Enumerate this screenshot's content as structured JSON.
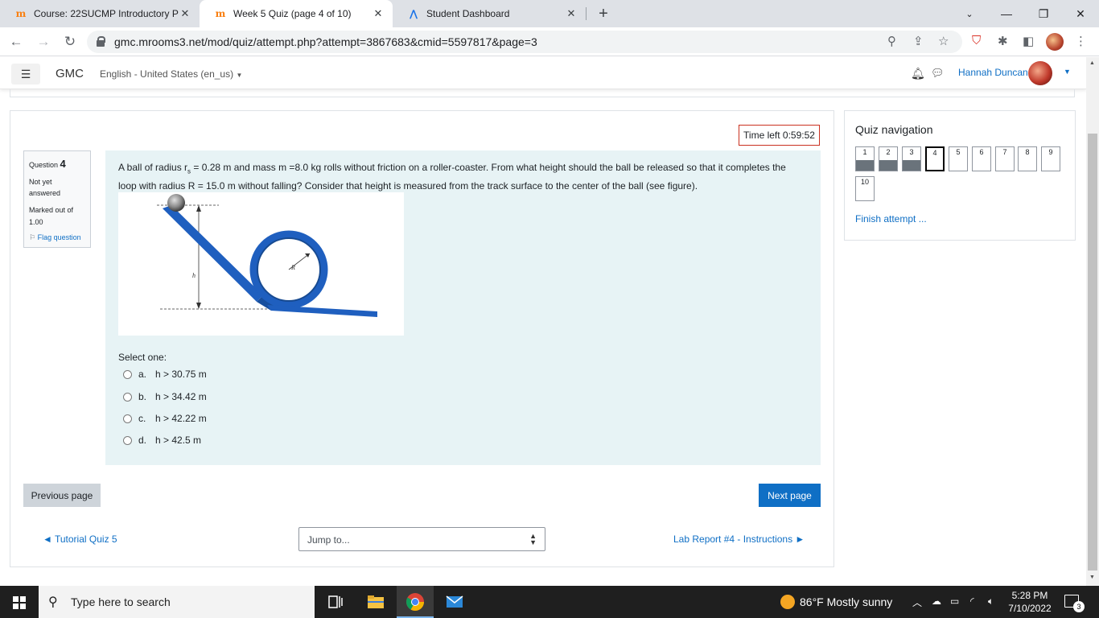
{
  "browser": {
    "tabs": [
      {
        "title": "Course: 22SUCMP Introductory P",
        "icon": "moodle-icon",
        "active": false
      },
      {
        "title": "Week 5 Quiz (page 4 of 10)",
        "icon": "moodle-icon",
        "active": true
      },
      {
        "title": "Student Dashboard",
        "icon": "student-dashboard-icon",
        "active": false
      }
    ],
    "url": "gmc.mrooms3.net/mod/quiz/attempt.php?attempt=3867683&cmid=5597817&page=3"
  },
  "navbar": {
    "brand": "GMC",
    "language": "English - United States (en_us)",
    "user_name": "Hannah Duncan"
  },
  "quiz": {
    "time_left": "Time left 0:59:52",
    "question_info": {
      "label": "Question",
      "number": "4",
      "state": "Not yet answered",
      "grade": "Marked out of 1.00",
      "flag": "Flag question"
    },
    "question_text_1": "A ball of radius r",
    "question_sub": "s",
    "question_text_2": " = 0.28 m and mass m =8.0 kg rolls without friction on a roller-coaster. From what height should the ball be released so that it completes the loop with radius R = 15.0 m without falling? Consider that height is measured from the track surface to the center of the ball (see figure).",
    "figure_labels": {
      "h": "h",
      "R": "R"
    },
    "select_one": "Select one:",
    "options": [
      {
        "letter": "a.",
        "text": "h > 30.75 m"
      },
      {
        "letter": "b.",
        "text": "h > 34.42 m"
      },
      {
        "letter": "c.",
        "text": "h > 42.22 m"
      },
      {
        "letter": "d.",
        "text": "h > 42.5 m"
      }
    ],
    "prev_button": "Previous page",
    "next_button": "Next page",
    "prev_activity": "◄ Tutorial Quiz 5",
    "jump_to": "Jump to...",
    "next_activity": "Lab Report #4 - Instructions ►"
  },
  "quiz_navigation": {
    "title": "Quiz navigation",
    "questions": [
      {
        "label": "1",
        "answered": true
      },
      {
        "label": "2",
        "answered": true
      },
      {
        "label": "3",
        "answered": true
      },
      {
        "label": "4",
        "answered": false,
        "current": true
      },
      {
        "label": "5",
        "answered": false
      },
      {
        "label": "6",
        "answered": false
      },
      {
        "label": "7",
        "answered": false
      },
      {
        "label": "8",
        "answered": false
      },
      {
        "label": "9",
        "answered": false
      },
      {
        "label": "10",
        "answered": false
      }
    ],
    "finish": "Finish attempt ..."
  },
  "taskbar": {
    "search_placeholder": "Type here to search",
    "weather": "86°F  Mostly sunny",
    "time": "5:28 PM",
    "date": "7/10/2022",
    "notifications": "3"
  },
  "colors": {
    "link": "#0f6fc5",
    "question_bg": "#e7f3f5",
    "timer_border": "#ca3120"
  }
}
